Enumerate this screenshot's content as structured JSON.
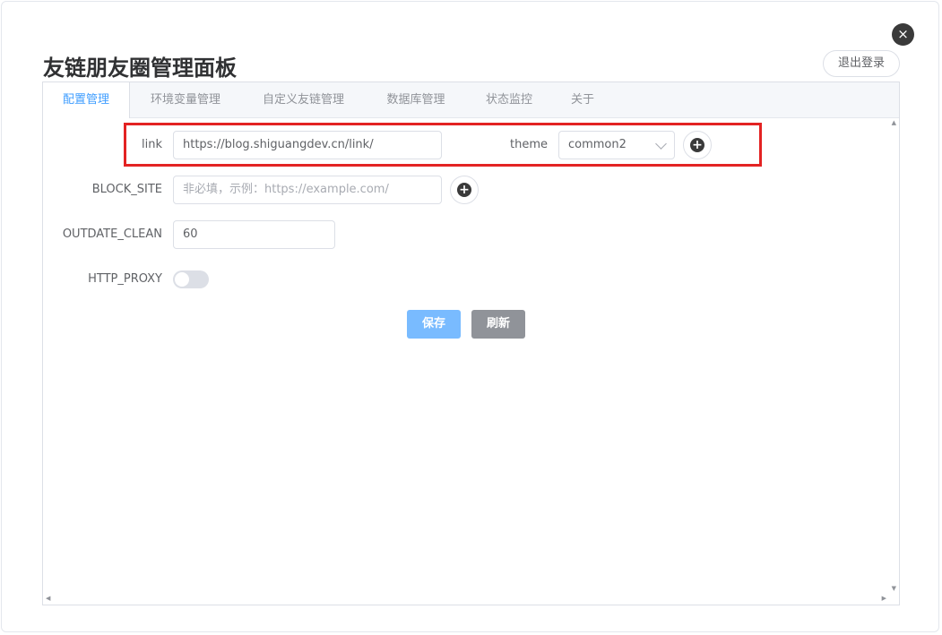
{
  "dialog": {
    "title": "友链朋友圈管理面板",
    "close_icon": "×",
    "logout_label": "退出登录"
  },
  "tabs": [
    {
      "label": "配置管理",
      "active": true
    },
    {
      "label": "环境变量管理",
      "active": false
    },
    {
      "label": "自定义友链管理",
      "active": false
    },
    {
      "label": "数据库管理",
      "active": false
    },
    {
      "label": "状态监控",
      "active": false
    },
    {
      "label": "关于",
      "active": false
    }
  ],
  "form": {
    "link_label": "link",
    "link_value": "https://blog.shiguangdev.cn/link/",
    "theme_label": "theme",
    "theme_value": "common2",
    "block_site_label": "BLOCK_SITE",
    "block_site_placeholder": "非必填，示例：https://example.com/",
    "outdate_clean_label": "OUTDATE_CLEAN",
    "outdate_clean_value": "60",
    "http_proxy_label": "HTTP_PROXY",
    "http_proxy_enabled": false
  },
  "actions": {
    "save_label": "保存",
    "refresh_label": "刷新"
  },
  "colors": {
    "accent": "#409eff",
    "highlight": "#e32323",
    "save_button": "#79bbff",
    "refresh_button": "#909399"
  }
}
